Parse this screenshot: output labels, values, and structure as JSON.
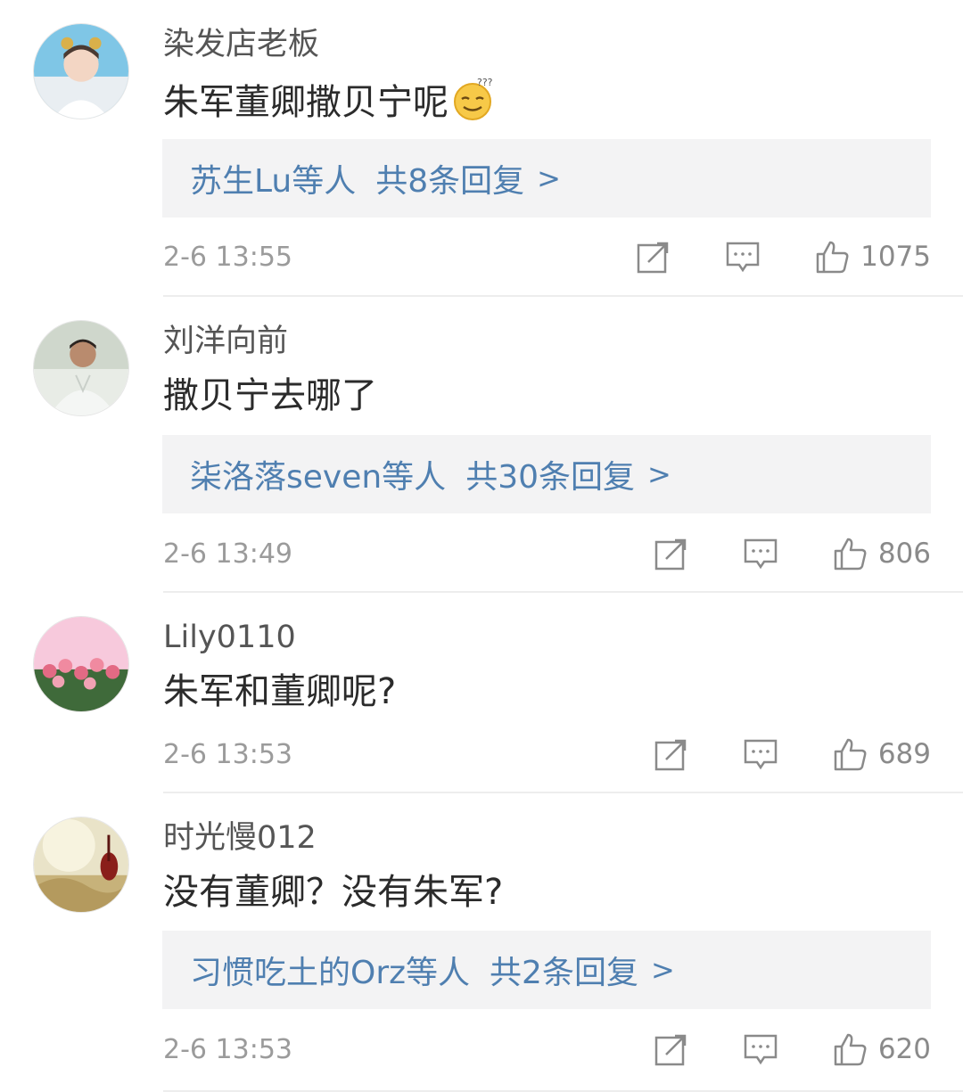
{
  "comments": [
    {
      "username": "染发店老板",
      "text": "朱军董卿撒贝宁呢",
      "emoji": "smug-thinking-emoji",
      "replies": {
        "who": "苏生Lu等人",
        "total": "共8条回复",
        "chevron": ">"
      },
      "time": "2-6 13:55",
      "likes": "1075"
    },
    {
      "username": "刘洋向前",
      "text": "撒贝宁去哪了",
      "replies": {
        "who": "柒洛落seven等人",
        "total": "共30条回复",
        "chevron": ">"
      },
      "time": "2-6 13:49",
      "likes": "806"
    },
    {
      "username": "Lily0110",
      "text": "朱军和董卿呢?",
      "time": "2-6 13:53",
      "likes": "689"
    },
    {
      "username": "时光慢012",
      "text": "没有董卿？没有朱军?",
      "replies": {
        "who": "习惯吃土的Orz等人",
        "total": "共2条回复",
        "chevron": ">"
      },
      "time": "2-6 13:53",
      "likes": "620"
    }
  ],
  "colors": {
    "reply_link": "#4f7fb0",
    "reply_bg": "#f3f3f4",
    "meta_text": "#9b9b9b",
    "divider": "#ededed"
  },
  "icons": [
    "share-icon",
    "comment-icon",
    "like-icon"
  ]
}
